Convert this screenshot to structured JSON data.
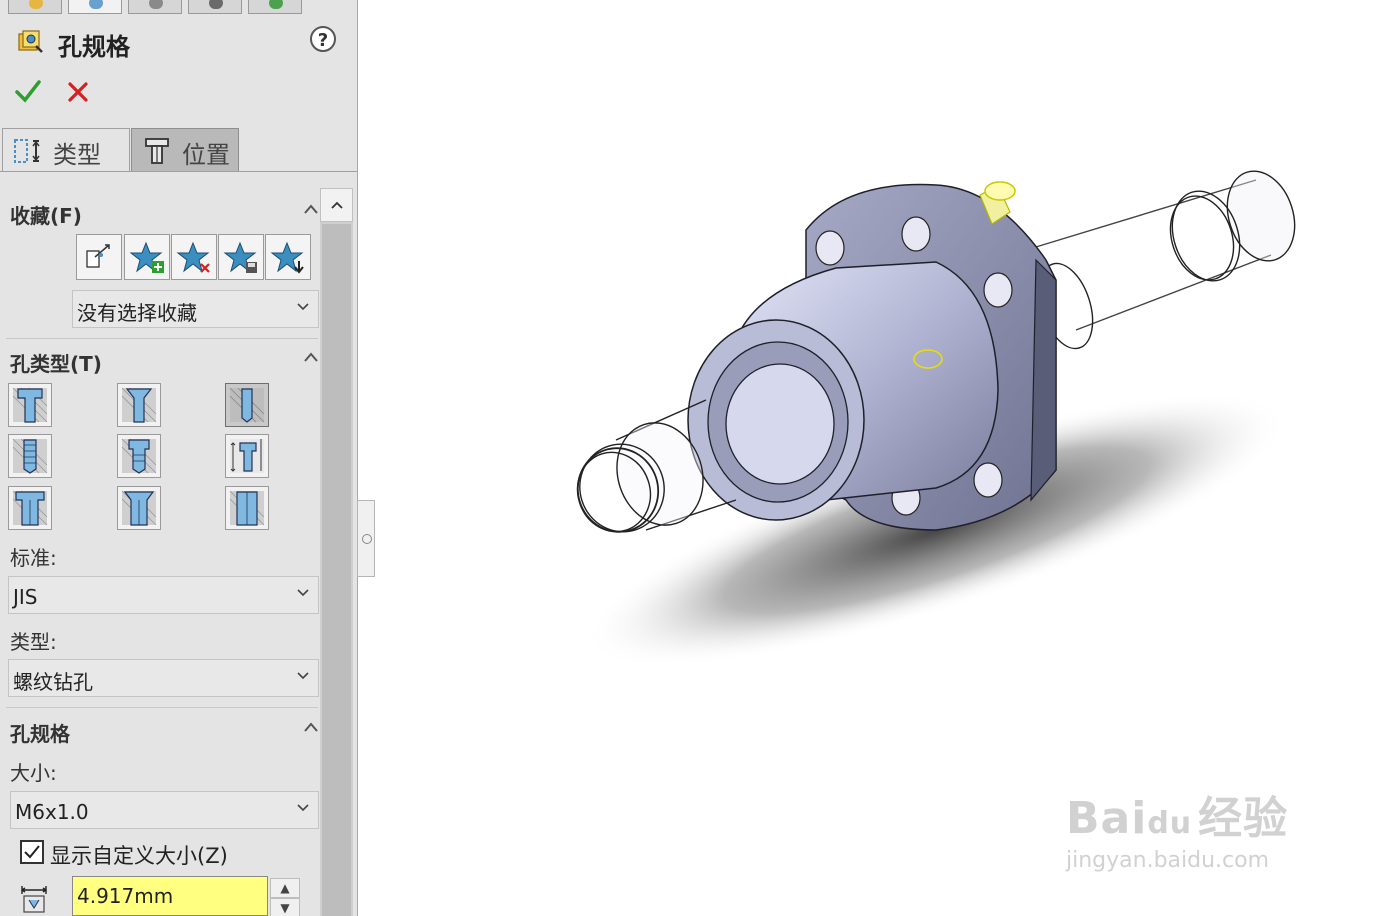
{
  "panel": {
    "title": "孔规格",
    "help_glyph": "?",
    "tabs": [
      {
        "label": "类型",
        "icon": "hole-type-icon"
      },
      {
        "label": "位置",
        "icon": "position-icon"
      }
    ],
    "favorites": {
      "title": "收藏(F)",
      "buttons": [
        "apply-defaults-icon",
        "add-favorite-icon",
        "delete-favorite-icon",
        "save-favorite-icon",
        "load-favorite-icon"
      ],
      "selected": "没有选择收藏"
    },
    "hole_type": {
      "title": "孔类型(T)",
      "buttons": [
        "counterbore",
        "countersink",
        "hole",
        "straight-tap",
        "tapered-tap",
        "legacy",
        "counterbore-slot",
        "countersink-slot",
        "slot"
      ],
      "selected_index": 2,
      "standard_label": "标准:",
      "standard_value": "JIS",
      "type_label": "类型:",
      "type_value": "螺纹钻孔"
    },
    "hole_spec": {
      "title": "孔规格",
      "size_label": "大小:",
      "size_value": "M6x1.0",
      "custom_size_label": "显示自定义大小(Z)",
      "custom_size_checked": true,
      "diameter_value": "4.917mm"
    }
  },
  "colors": {
    "accent_blue": "#4a8fc8",
    "selection_yellow": "#ffff80",
    "ok_green": "#2e9e2e",
    "cancel_red": "#d42020"
  },
  "watermark": {
    "brand": "Bai",
    "brand2": "du",
    "suffix": "经验",
    "url": "jingyan.baidu.com"
  }
}
